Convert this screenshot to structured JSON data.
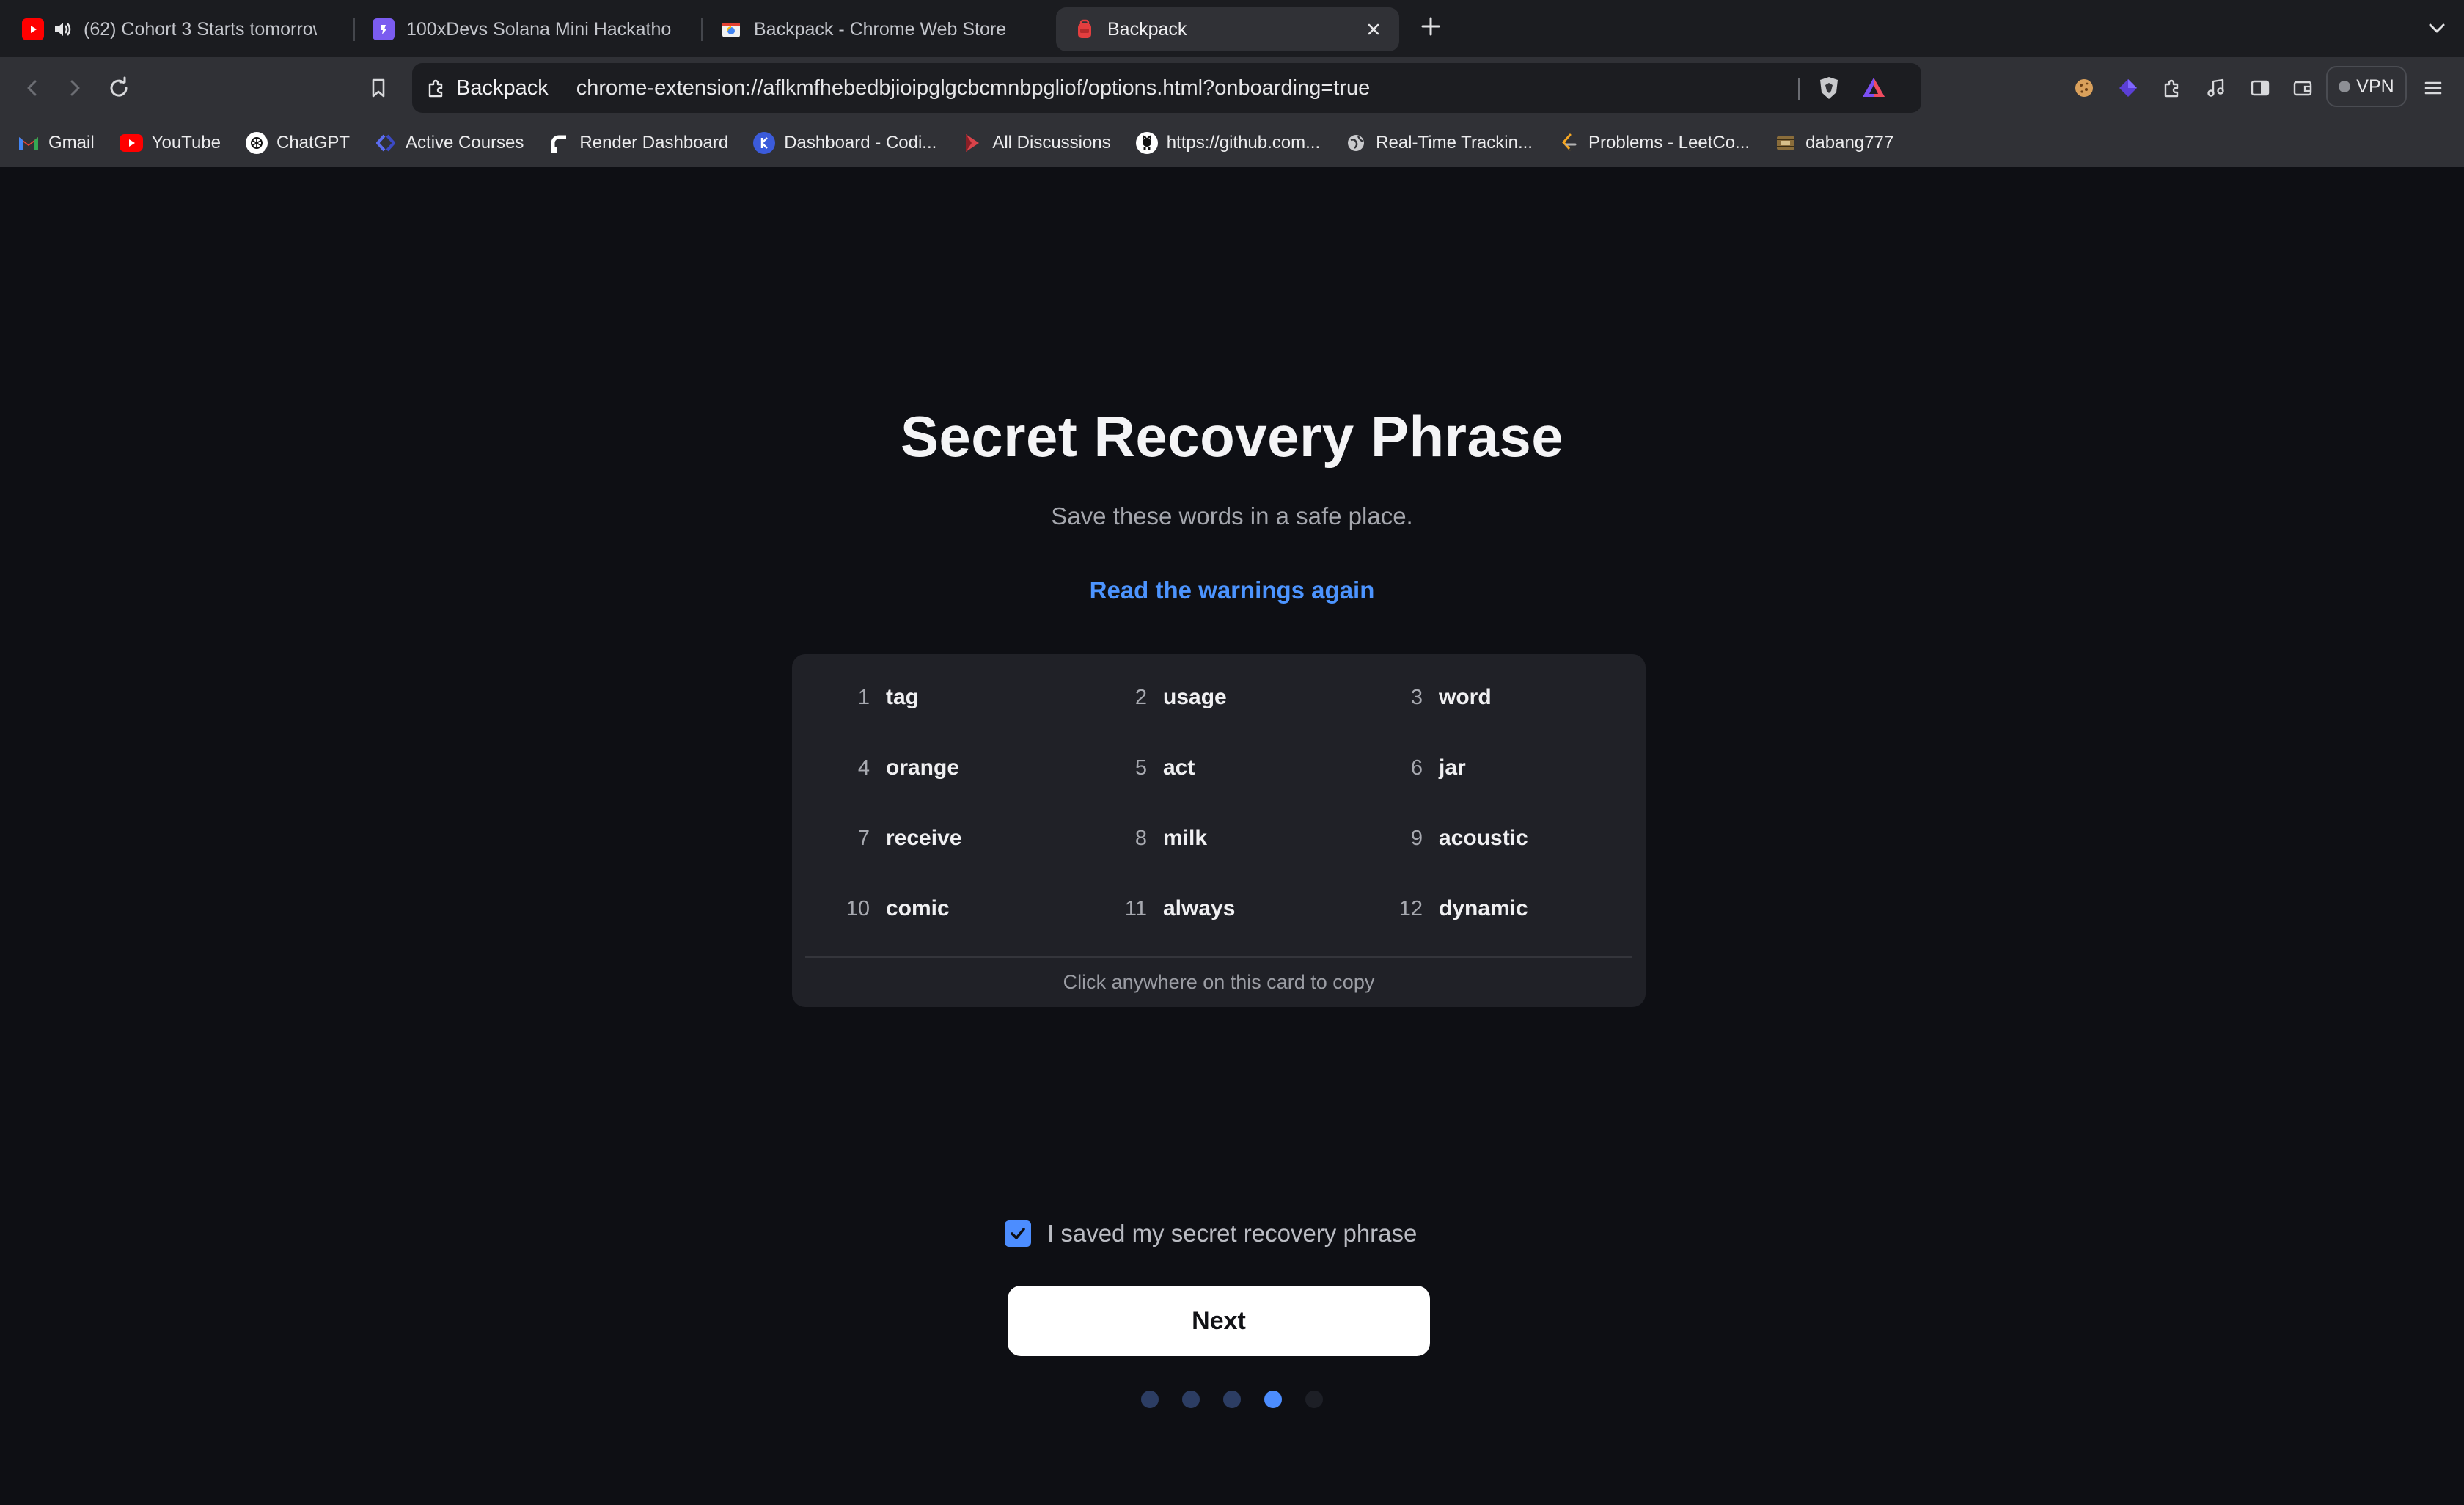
{
  "tabs": [
    {
      "title": "(62) Cohort 3 Starts tomorrow",
      "favicon": "youtube-icon",
      "audio": true,
      "active": false
    },
    {
      "title": "100xDevs Solana Mini Hackathon",
      "favicon": "hackathon-icon",
      "active": false
    },
    {
      "title": "Backpack - Chrome Web Store",
      "favicon": "webstore-icon",
      "active": false
    },
    {
      "title": "Backpack",
      "favicon": "backpack-icon",
      "active": true
    }
  ],
  "toolbar": {
    "site_label": "Backpack",
    "url": "chrome-extension://aflkmfhebedbjioipglgcbcmnbpgliof/options.html?onboarding=true",
    "vpn_label": "VPN"
  },
  "bookmarks": [
    {
      "label": "Gmail",
      "icon": "gmail-icon"
    },
    {
      "label": "YouTube",
      "icon": "youtube-icon"
    },
    {
      "label": "ChatGPT",
      "icon": "chatgpt-icon"
    },
    {
      "label": "Active Courses",
      "icon": "courses-icon"
    },
    {
      "label": "Render Dashboard",
      "icon": "render-icon"
    },
    {
      "label": "Dashboard - Codi...",
      "icon": "coding-icon"
    },
    {
      "label": "All Discussions",
      "icon": "discussions-icon"
    },
    {
      "label": "https://github.com...",
      "icon": "github-icon"
    },
    {
      "label": "Real-Time Trackin...",
      "icon": "globe-icon"
    },
    {
      "label": "Problems - LeetCo...",
      "icon": "leetcode-icon"
    },
    {
      "label": "dabang777",
      "icon": "film-icon"
    }
  ],
  "onboarding": {
    "title": "Secret Recovery Phrase",
    "subtitle": "Save these words in a safe place.",
    "warnings_link": "Read the warnings again",
    "words": [
      {
        "n": "1",
        "word": "tag"
      },
      {
        "n": "2",
        "word": "usage"
      },
      {
        "n": "3",
        "word": "word"
      },
      {
        "n": "4",
        "word": "orange"
      },
      {
        "n": "5",
        "word": "act"
      },
      {
        "n": "6",
        "word": "jar"
      },
      {
        "n": "7",
        "word": "receive"
      },
      {
        "n": "8",
        "word": "milk"
      },
      {
        "n": "9",
        "word": "acoustic"
      },
      {
        "n": "10",
        "word": "comic"
      },
      {
        "n": "11",
        "word": "always"
      },
      {
        "n": "12",
        "word": "dynamic"
      }
    ],
    "copy_hint": "Click anywhere on this card to copy",
    "confirm_label": "I saved my secret recovery phrase",
    "confirm_checked": true,
    "next_label": "Next",
    "steps_total": 5,
    "steps_current": 4
  },
  "colors": {
    "accent": "#4c8dff",
    "link": "#4c94ff",
    "background": "#0e0f14",
    "card": "#202127"
  }
}
